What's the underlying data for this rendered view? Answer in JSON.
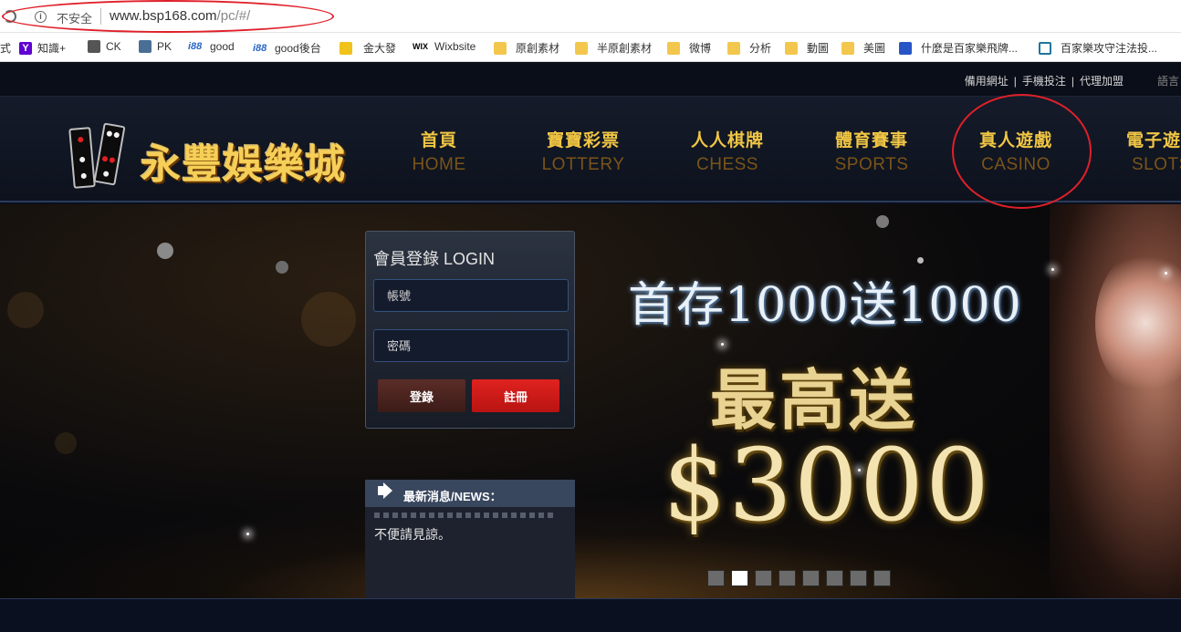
{
  "browser": {
    "insecure_label": "不安全",
    "url_host": "www.bsp168.com",
    "url_path": "/pc/#/",
    "bookmarks": [
      {
        "label": "式",
        "icon": "bookmark-partial"
      },
      {
        "label": "知識+",
        "icon": "yahoo-icon"
      },
      {
        "label": "CK",
        "icon": "site-icon"
      },
      {
        "label": "PK",
        "icon": "site-icon"
      },
      {
        "label": "good",
        "icon": "i88-icon"
      },
      {
        "label": "good後台",
        "icon": "i88-icon"
      },
      {
        "label": "金大發",
        "icon": "site-icon"
      },
      {
        "label": "Wixbsite",
        "icon": "wix-icon"
      },
      {
        "label": "原創素材",
        "icon": "folder-icon"
      },
      {
        "label": "半原創素材",
        "icon": "folder-icon"
      },
      {
        "label": "微博",
        "icon": "folder-icon"
      },
      {
        "label": "分析",
        "icon": "folder-icon"
      },
      {
        "label": "動圖",
        "icon": "folder-icon"
      },
      {
        "label": "美圖",
        "icon": "folder-icon"
      },
      {
        "label": "什麼是百家樂飛牌...",
        "icon": "chat-icon"
      },
      {
        "label": "百家樂攻守注法投...",
        "icon": "wordpress-icon"
      }
    ],
    "i88_prefix": "i88",
    "wix_prefix": "WIX",
    "yahoo_prefix": "Y"
  },
  "site": {
    "toplinks": [
      "備用網址",
      "手機投注",
      "代理加盟"
    ],
    "toplink_sep": "|",
    "lang": "語言",
    "logo_text": "永豐娛樂城",
    "nav": [
      {
        "zh": "首頁",
        "en": "HOME"
      },
      {
        "zh": "寶寶彩票",
        "en": "LOTTERY"
      },
      {
        "zh": "人人棋牌",
        "en": "CHESS"
      },
      {
        "zh": "體育賽事",
        "en": "SPORTS"
      },
      {
        "zh": "真人遊戲",
        "en": "CASINO"
      },
      {
        "zh": "電子遊藝",
        "en": "SLOTS"
      }
    ],
    "login": {
      "title": "會員登錄 LOGIN",
      "account_placeholder": "帳號",
      "password_placeholder": "密碼",
      "login_button": "登錄",
      "register_button": "註冊"
    },
    "news": {
      "title": "最新消息/NEWS：",
      "text": "不便請見諒。"
    },
    "promo": {
      "line1": "首存1000送1000",
      "line2": "最高送",
      "line3": "$3000"
    },
    "carousel": {
      "count": 8,
      "active_index": 1
    }
  },
  "colors": {
    "annotation": "#e0202a",
    "nav_gold": "#f1c644",
    "register_red": "#e0221f"
  }
}
